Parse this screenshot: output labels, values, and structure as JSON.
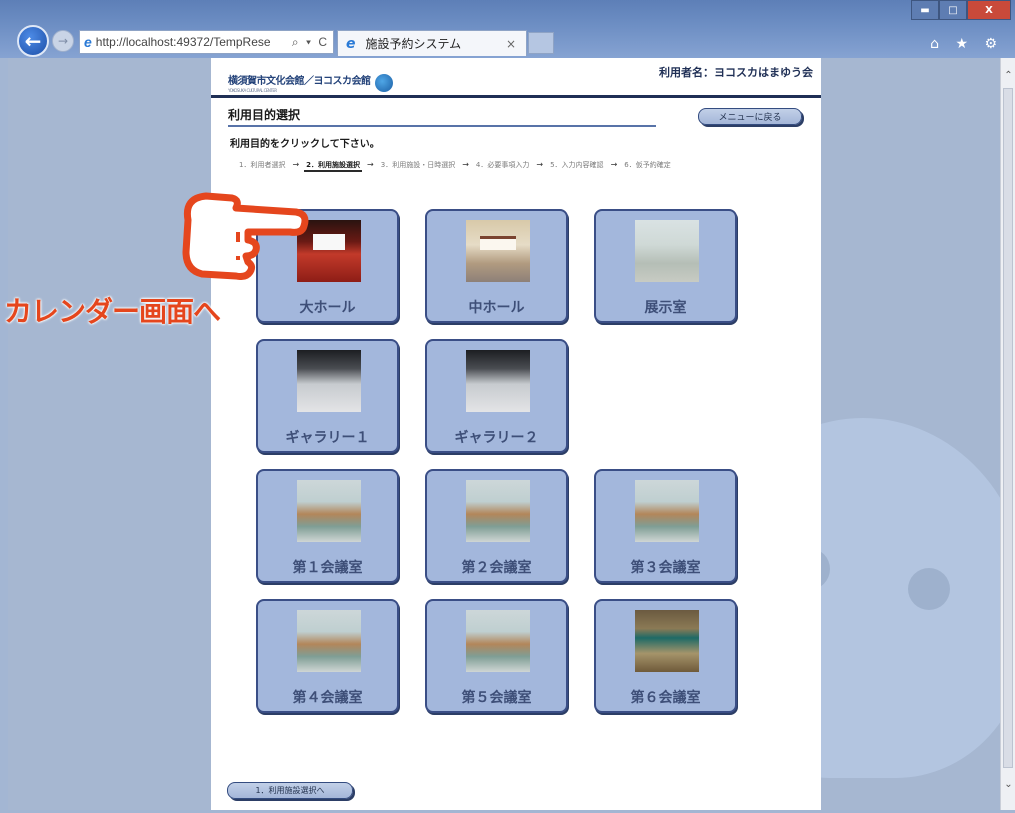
{
  "browser": {
    "url": "http://localhost:49372/TempRese",
    "address_controls": "⌕ ▾ C",
    "tab_title": "施設予約システム",
    "tab_close": "×",
    "window_buttons": {
      "minimize": "▬",
      "maximize": "□",
      "close": "X"
    },
    "toolbar_icons": "⌂ ★ ⚙",
    "scroll_up": "⌃",
    "scroll_down": "⌄"
  },
  "header": {
    "logo_text": "横須賀市文化会館／ヨコスカ会館",
    "logo_sub": "YOKOSUKA CULTURAL CENTER",
    "username": "利用者名：ヨコスカはまゆう会"
  },
  "section": {
    "title": "利用目的選択",
    "menu_button": "メニューに戻る",
    "instruction": "利用目的をクリックして下さい。"
  },
  "steps": [
    {
      "label": "1．利用者選択",
      "active": false
    },
    {
      "label": "2．利用施設選択",
      "active": true
    },
    {
      "label": "3．利用施設・日時選択",
      "active": false
    },
    {
      "label": "4．必要事項入力",
      "active": false
    },
    {
      "label": "5．入力内容確認",
      "active": false
    },
    {
      "label": "6．仮予約確定",
      "active": false
    }
  ],
  "step_arrow": "→",
  "facilities": [
    {
      "name": "大ホール",
      "image": "hall"
    },
    {
      "name": "中ホール",
      "image": "mid"
    },
    {
      "name": "展示室",
      "image": "ex"
    },
    {
      "name": "ギャラリー１",
      "image": "gal"
    },
    {
      "name": "ギャラリー２",
      "image": "gal"
    },
    {
      "name": "第１会議室",
      "image": "meet"
    },
    {
      "name": "第２会議室",
      "image": "meet"
    },
    {
      "name": "第３会議室",
      "image": "meet"
    },
    {
      "name": "第４会議室",
      "image": "meet"
    },
    {
      "name": "第５会議室",
      "image": "meet"
    },
    {
      "name": "第６会議室",
      "image": "jp"
    }
  ],
  "bottom_button": "1．利用施設選択へ",
  "annotation": {
    "text": "カレンダー画面へ",
    "color": "#e5461d",
    "icon": "pointing-hand-icon"
  }
}
